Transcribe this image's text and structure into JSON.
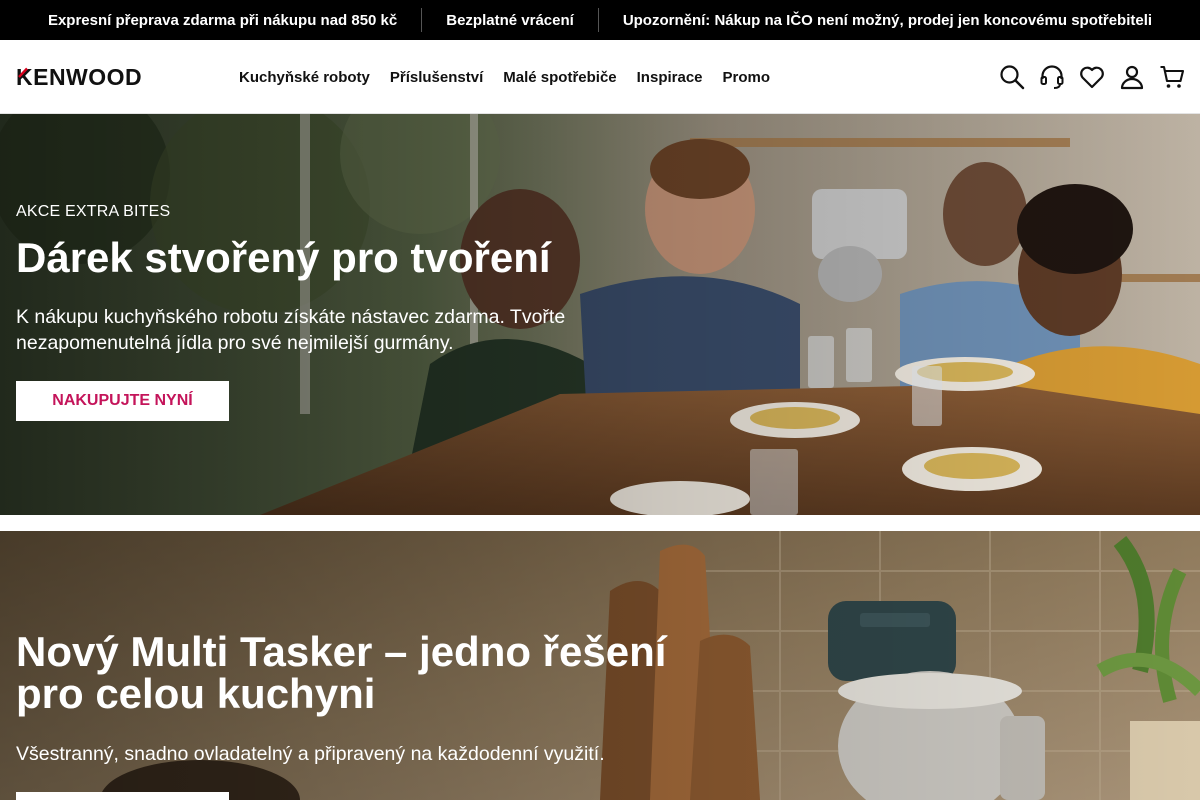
{
  "announcement": {
    "messages": [
      "Expresní přeprava zdarma při nákupu nad 850 kč",
      "Bezplatné vrácení",
      "Upozornění: Nákup na IČO není možný, prodej jen koncovému spotřebiteli"
    ]
  },
  "header": {
    "logo_text": "KENWOOD",
    "nav": [
      "Kuchyňské roboty",
      "Příslušenství",
      "Malé spotřebiče",
      "Inspirace",
      "Promo"
    ],
    "icons": [
      "search-icon",
      "headset-icon",
      "heart-icon",
      "user-icon",
      "cart-icon"
    ]
  },
  "hero1": {
    "eyebrow": "AKCE EXTRA BITES",
    "title": "Dárek stvořený pro tvoření",
    "description": "K nákupu kuchyňského robotu získáte nástavec zdarma. Tvořte nezapomenutelná jídla pro své nejmilejší gurmány.",
    "cta": "NAKUPUJTE NYNÍ"
  },
  "hero2": {
    "title_line1": "Nový Multi Tasker – jedno řešení",
    "title_line2": "pro celou kuchyni",
    "description": "Všestranný, snadno ovladatelný a připravený na každodenní využití.",
    "cta": ""
  },
  "colors": {
    "accent": "#c4145a",
    "brand_red": "#d6001c",
    "black": "#000000"
  }
}
